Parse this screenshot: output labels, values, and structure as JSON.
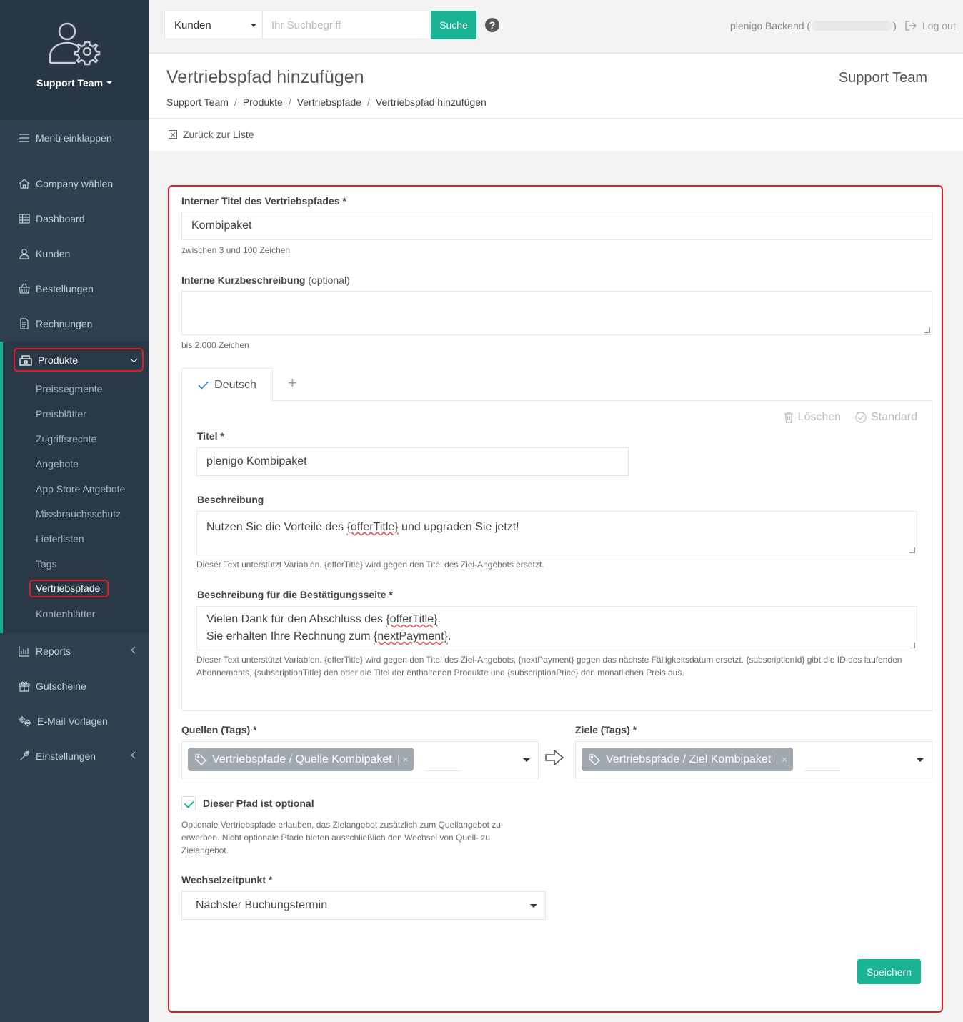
{
  "sidebar": {
    "team_label": "Support Team",
    "collapse_label": "Menü einklappen",
    "items": [
      {
        "label": "Company wählen",
        "icon": "home-icon"
      },
      {
        "label": "Dashboard",
        "icon": "grid-icon"
      },
      {
        "label": "Kunden",
        "icon": "user-icon"
      },
      {
        "label": "Bestellungen",
        "icon": "basket-icon"
      },
      {
        "label": "Rechnungen",
        "icon": "document-icon"
      },
      {
        "label": "Produkte",
        "icon": "shop-icon"
      },
      {
        "label": "Reports",
        "icon": "bar-chart-icon"
      },
      {
        "label": "Gutscheine",
        "icon": "gift-icon"
      },
      {
        "label": "E-Mail Vorlagen",
        "icon": "gears-icon"
      },
      {
        "label": "Einstellungen",
        "icon": "wrench-icon"
      }
    ],
    "subitems": [
      "Preissegmente",
      "Preisblätter",
      "Zugriffsrechte",
      "Angebote",
      "App Store Angebote",
      "Missbrauchsschutz",
      "Lieferlisten",
      "Tags",
      "Vertriebspfade",
      "Kontenblätter"
    ]
  },
  "topbar": {
    "search_scope": "Kunden",
    "search_placeholder": "Ihr Suchbegriff",
    "search_button": "Suche",
    "help": "?",
    "backend_prefix": "plenigo Backend (",
    "backend_suffix": ")",
    "logout": "Log out"
  },
  "heading": {
    "title": "Vertriebspfad hinzufügen",
    "right": "Support Team",
    "breadcrumb": [
      "Support Team",
      "Produkte",
      "Vertriebspfade",
      "Vertriebspfad hinzufügen"
    ],
    "sep": "/",
    "back": "Zurück zur Liste"
  },
  "form": {
    "internal_title_label": "Interner Titel des Vertriebspfades",
    "internal_title_value": "Kombipaket",
    "internal_title_help": "zwischen 3 und 100 Zeichen",
    "short_desc_label": "Interne Kurzbeschreibung",
    "short_desc_optional": "(optional)",
    "short_desc_value": "",
    "short_desc_help": "bis 2.000 Zeichen",
    "required_mark": "*",
    "tab_label": "Deutsch",
    "tab_add": "+",
    "delete_label": "Löschen",
    "default_label": "Standard",
    "title_label": "Titel",
    "title_value": "plenigo Kombipaket",
    "desc_label": "Beschreibung",
    "desc_before": "Nutzen Sie die Vorteile des ",
    "desc_var": "{offerTitle}",
    "desc_after": " und upgraden Sie jetzt!",
    "desc_help": "Dieser Text unterstützt Variablen. {offerTitle} wird gegen den Titel des Ziel-Angebots ersetzt.",
    "confirm_label": "Beschreibung für die Bestätigungsseite",
    "confirm_line1_before": "Vielen Dank für den Abschluss des ",
    "confirm_line1_var": "{offerTitle}",
    "confirm_line1_after": ".",
    "confirm_line2_before": "Sie erhalten Ihre Rechnung zum ",
    "confirm_line2_var": "{nextPayment}",
    "confirm_line2_after": ".",
    "confirm_help": "Dieser Text unterstützt Variablen. {offerTitle} wird gegen den Titel des Ziel-Angebots, {nextPayment} gegen das nächste Fälligkeitsdatum ersetzt. {subscriptionId} gibt die ID des laufenden Abonnements, {subscriptionTitle} den oder die Titel der enthaltenen Produkte und {subscriptionPrice} den monatlichen Preis aus.",
    "sources_label": "Quellen (Tags)",
    "sources_tag": "Vertriebspfade / Quelle Kombipaket",
    "targets_label": "Ziele (Tags)",
    "targets_tag": "Vertriebspfade / Ziel Kombipaket",
    "tag_remove": "×",
    "optional_label": "Dieser Pfad ist optional",
    "optional_checked": true,
    "optional_help": "Optionale Vertriebspfade erlauben, das Zielangebot zusätzlich zum Quellangebot zu erwerben. Nicht optionale Pfade bieten ausschließlich den Wechsel von Quell- zu Zielangebot.",
    "switch_label": "Wechselzeitpunkt",
    "switch_value": "Nächster Buchungstermin",
    "save": "Speichern"
  },
  "colors": {
    "accent": "#1ab394",
    "sidebar": "#2f4050",
    "highlight": "#e01b24"
  }
}
